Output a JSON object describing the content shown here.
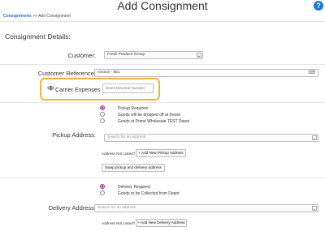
{
  "header": {
    "title": "Add Consignment",
    "help_icon": "help-icon",
    "breadcrumb": {
      "link": "Consignments",
      "separator": ">>",
      "current": "Add Consignment"
    }
  },
  "form": {
    "section_title": "Consignment Details:",
    "customer": {
      "label": "Customer:",
      "value": "Fresh Produce Group"
    },
    "customer_reference": {
      "label": "Customer Reference:",
      "value": "Invoice - 561",
      "icon": "keyboard-icon"
    },
    "carrier_expenses": {
      "label": "Carrier Expenses",
      "placeholder": "Enter Decimal Number",
      "icon": "eye-icon",
      "highlight_color": "#f2b33d"
    },
    "pickup": {
      "options": [
        {
          "label": "Pickup Required",
          "selected": true
        },
        {
          "label": "Goods will be dropped off at Depot",
          "selected": false
        },
        {
          "label": "Goods at Prime Wholesale TEST Depot",
          "selected": false
        }
      ],
      "address_label": "Pickup Address:",
      "search_placeholder": "Search for an address",
      "not_listed": "Address Not Listed?",
      "add_button": "+ Add New Pickup Address",
      "swap_button": "Swap pickup and delivery address"
    },
    "delivery": {
      "options": [
        {
          "label": "Delivery Required",
          "selected": true
        },
        {
          "label": "Goods to be Collected from Depot",
          "selected": false
        }
      ],
      "address_label": "Delivery Address:",
      "search_placeholder": "Search for an address",
      "not_listed": "Address Not Listed?",
      "add_button": "+ Add New Delivery Address"
    }
  },
  "colors": {
    "accent": "#b02a8c",
    "link": "#2a6ebb",
    "help": "#1b78cf"
  }
}
